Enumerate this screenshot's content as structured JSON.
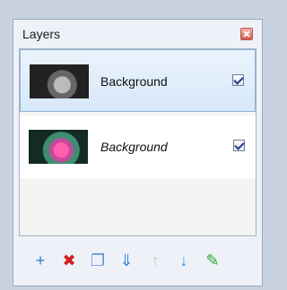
{
  "panel": {
    "title": "Layers",
    "layers": [
      {
        "name": "Background",
        "checked": true
      },
      {
        "name": "Background",
        "checked": true
      }
    ]
  },
  "toolbar": {
    "icons": [
      {
        "name": "new-layer-icon",
        "glyph": "+"
      },
      {
        "name": "delete-layer-icon",
        "glyph": "✖"
      },
      {
        "name": "duplicate-layer-icon",
        "glyph": "❐"
      },
      {
        "name": "merge-down-icon",
        "glyph": "⇓"
      },
      {
        "name": "move-up-icon",
        "glyph": "↑"
      },
      {
        "name": "move-down-icon",
        "glyph": "↓"
      },
      {
        "name": "properties-icon",
        "glyph": "✎"
      }
    ]
  }
}
